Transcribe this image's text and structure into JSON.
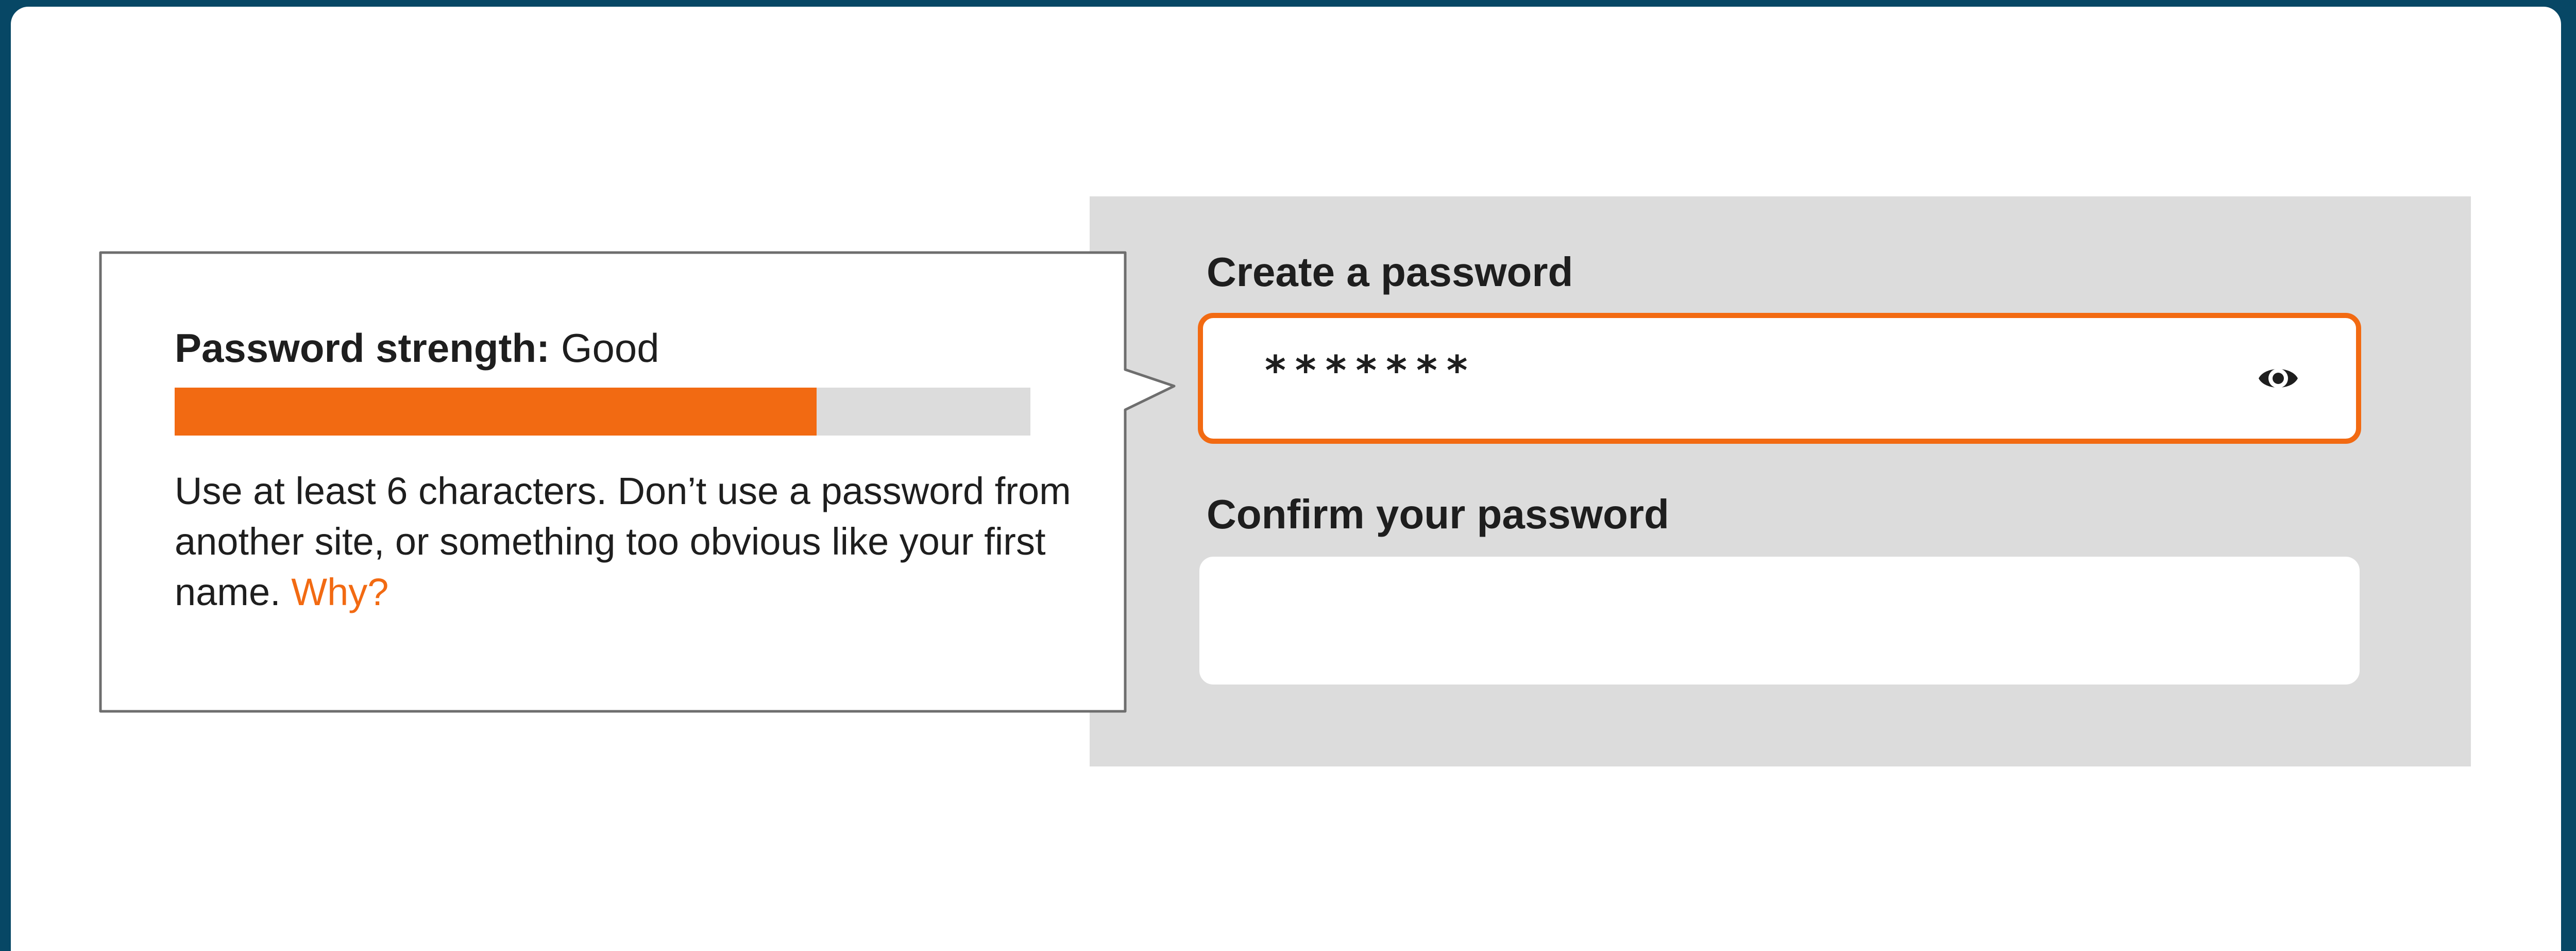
{
  "colors": {
    "background": "#074765",
    "card": "#ffffff",
    "panel": "#dcdcdc",
    "accent": "#f26a12",
    "text": "#1e1e1e"
  },
  "tooltip": {
    "strength_title": "Password strength:",
    "strength_value": "Good",
    "strength_fraction": 0.75,
    "help_text": "Use at least 6 characters. Don’t use a password from another site, or something too obvious like your first name.",
    "why_link": "Why?"
  },
  "form": {
    "create_label": "Create a password",
    "create_value": "*******",
    "show_password_icon": "eye-icon",
    "confirm_label": "Confirm your password",
    "confirm_value": ""
  }
}
